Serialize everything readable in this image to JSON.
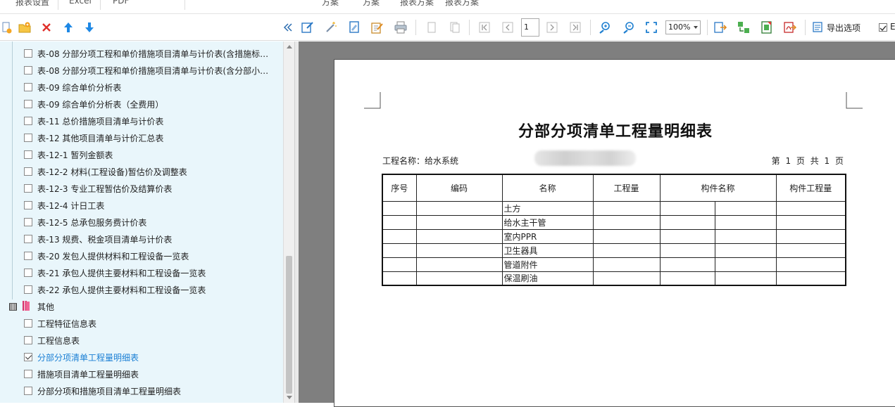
{
  "topbar": {
    "items": [
      "报表设置",
      "Excel",
      "PDF",
      "方案",
      "方案",
      "报表方案",
      "报表方案"
    ]
  },
  "toolbar": {
    "page_number": "1",
    "zoom": "100%",
    "export_label": "导出选项",
    "cut_off_label": "E"
  },
  "tree": {
    "items": [
      {
        "label": "表-08 分部分项工程和单价措施项目清单与计价表(含措施标…",
        "checked": false
      },
      {
        "label": "表-08 分部分项工程和单价措施项目清单与计价表(含分部小…",
        "checked": false
      },
      {
        "label": "表-09 综合单价分析表",
        "checked": false
      },
      {
        "label": "表-09 综合单价分析表（全费用）",
        "checked": false
      },
      {
        "label": "表-11 总价措施项目清单与计价表",
        "checked": false
      },
      {
        "label": "表-12 其他项目清单与计价汇总表",
        "checked": false
      },
      {
        "label": "表-12-1 暂列金额表",
        "checked": false
      },
      {
        "label": "表-12-2 材料(工程设备)暂估价及调整表",
        "checked": false
      },
      {
        "label": "表-12-3 专业工程暂估价及结算价表",
        "checked": false
      },
      {
        "label": "表-12-4 计日工表",
        "checked": false
      },
      {
        "label": "表-12-5 总承包服务费计价表",
        "checked": false
      },
      {
        "label": "表-13 规费、税金项目清单与计价表",
        "checked": false
      },
      {
        "label": "表-20 发包人提供材料和工程设备一览表",
        "checked": false
      },
      {
        "label": "表-21 承包人提供主要材料和工程设备一览表",
        "checked": false
      },
      {
        "label": "表-22 承包人提供主要材料和工程设备一览表",
        "checked": false
      }
    ],
    "group_label": "其他",
    "group_items": [
      {
        "label": "工程特征信息表",
        "checked": false
      },
      {
        "label": "工程信息表",
        "checked": false
      },
      {
        "label": "分部分项清单工程量明细表",
        "checked": true
      },
      {
        "label": "措施项目清单工程量明细表",
        "checked": false
      },
      {
        "label": "分部分项和措施项目清单工程量明细表",
        "checked": false
      }
    ]
  },
  "report": {
    "title": "分部分项清单工程量明细表",
    "project_label": "工程名称：给水系统",
    "page_info": "第 1 页  共 1 页",
    "columns": [
      "序号",
      "编码",
      "名称",
      "工程量",
      "构件名称",
      "构件工程量"
    ],
    "rows": [
      [
        "",
        "",
        "土方",
        "",
        "",
        "",
        ""
      ],
      [
        "",
        "",
        "给水主干管",
        "",
        "",
        "",
        ""
      ],
      [
        "",
        "",
        "室内PPR",
        "",
        "",
        "",
        ""
      ],
      [
        "",
        "",
        "卫生器具",
        "",
        "",
        "",
        ""
      ],
      [
        "",
        "",
        "管道附件",
        "",
        "",
        "",
        ""
      ],
      [
        "",
        "",
        "保温刷油",
        "",
        "",
        "",
        ""
      ]
    ]
  },
  "colors": {
    "tree_bg": "#e9f6fb",
    "selected_text": "#1a7fd4",
    "preview_bg": "#7f7f7f",
    "delete_red": "#e0302a",
    "arrow_blue": "#1e88e5"
  }
}
